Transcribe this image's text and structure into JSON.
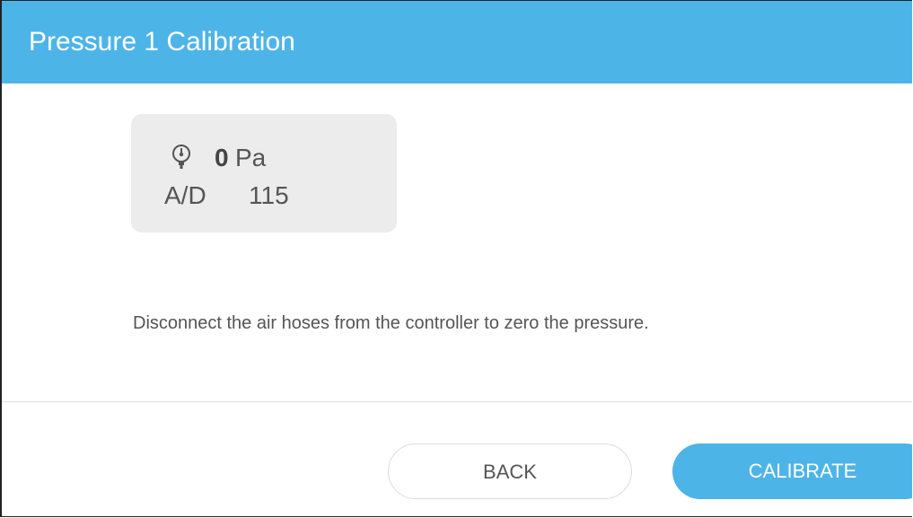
{
  "dialog": {
    "title": "Pressure 1 Calibration",
    "instruction": "Disconnect the air hoses from the controller to zero the pressure."
  },
  "reading": {
    "icon": "pressure-gauge-icon",
    "value": "0",
    "unit": "Pa",
    "ad_label": "A/D",
    "ad_value": "115"
  },
  "buttons": {
    "back_label": "BACK",
    "calibrate_label": "CALIBRATE"
  },
  "colors": {
    "accent": "#4db4e8",
    "card_background": "#ececec"
  }
}
